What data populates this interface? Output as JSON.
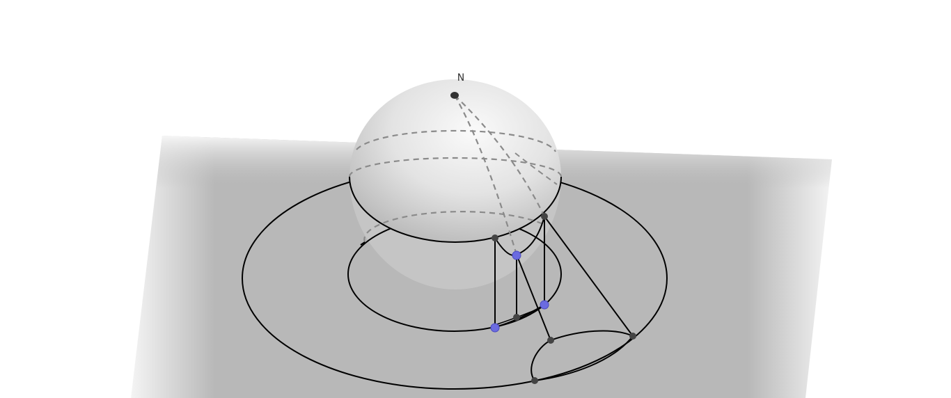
{
  "labels": {
    "north": "N"
  },
  "colors": {
    "background": "#ffffff",
    "plane": "#b8b8b8",
    "plane_edge": "#f2f2f2",
    "sphere_light": "#f4f4f4",
    "sphere_dark": "#bdbdbd",
    "curve": "#000000",
    "dashed": "#8a8a8a",
    "point_dark": "#404040",
    "point_free": "#6b6be0"
  }
}
